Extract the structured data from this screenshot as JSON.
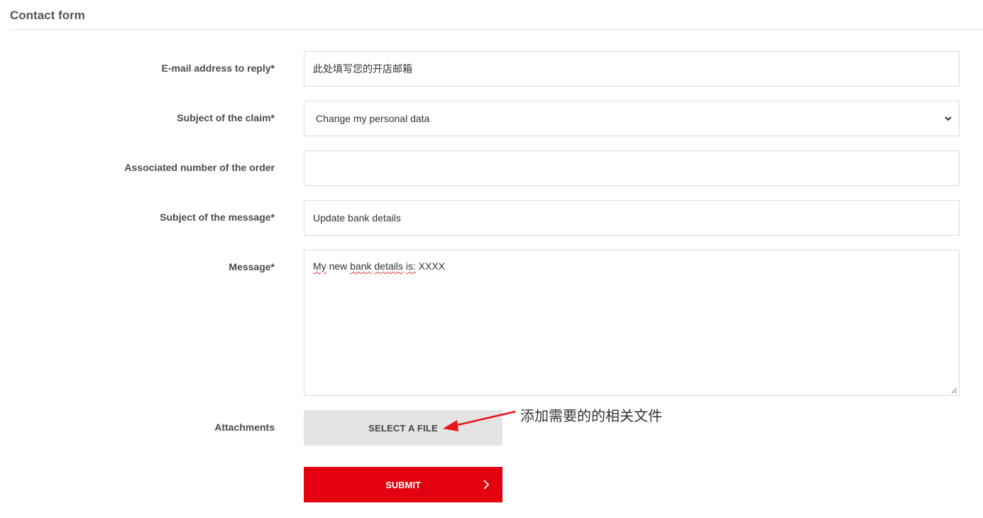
{
  "header": {
    "title": "Contact form"
  },
  "form": {
    "email": {
      "label": "E-mail address to reply*",
      "value": "此处填写您的开店邮箱"
    },
    "claim_subject": {
      "label": "Subject of the claim*",
      "selected": "Change my personal data"
    },
    "order_number": {
      "label": "Associated number of the order",
      "value": ""
    },
    "message_subject": {
      "label": "Subject of the message*",
      "value": "Update bank details"
    },
    "message": {
      "label": "Message*",
      "words": [
        "My",
        "new",
        "bank",
        "details",
        "is:",
        "XXXX"
      ]
    },
    "attachments": {
      "label": "Attachments",
      "button": "SELECT A FILE"
    },
    "submit": {
      "label": "SUBMIT"
    }
  },
  "annotation": {
    "text": "添加需要的的相关文件",
    "color": "#e8151b"
  },
  "colors": {
    "accent": "#e3000f",
    "file_button_bg": "#e4e4e2"
  }
}
